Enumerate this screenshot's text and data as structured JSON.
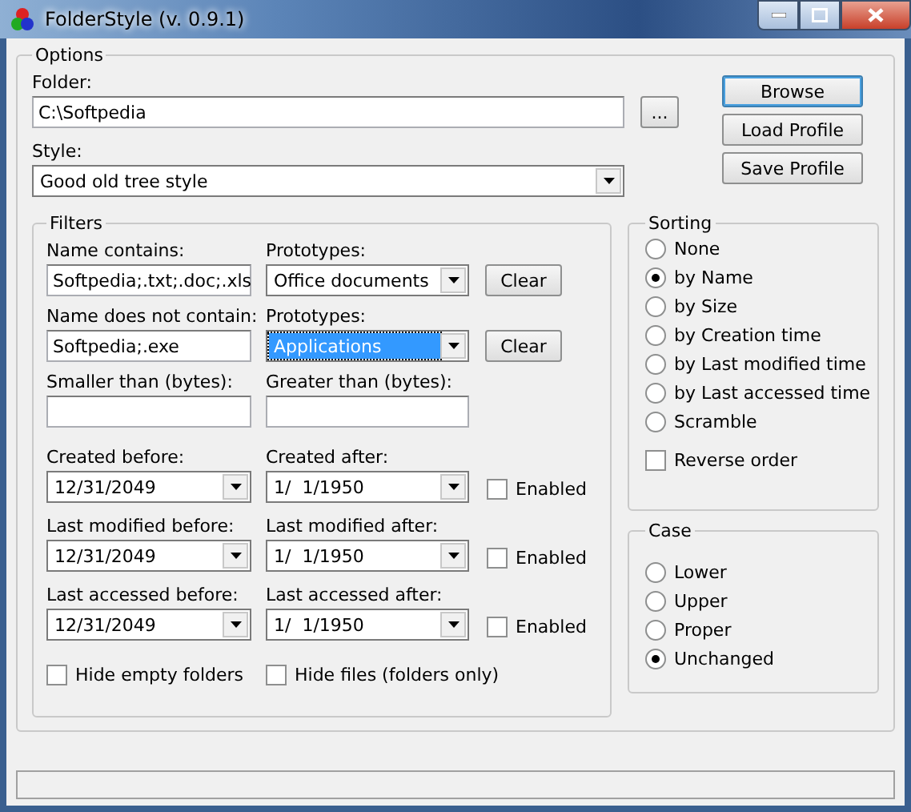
{
  "window": {
    "title": "FolderStyle (v. 0.9.1)"
  },
  "options": {
    "legend": "Options",
    "folder": {
      "label": "Folder:",
      "value": "C:\\Softpedia",
      "browse": "..."
    },
    "style": {
      "label": "Style:",
      "value": "Good old tree style"
    },
    "buttons": [
      {
        "label": "Browse",
        "default": true
      },
      {
        "label": "Load Profile",
        "default": false
      },
      {
        "label": "Save Profile",
        "default": false
      }
    ]
  },
  "filters": {
    "legend": "Filters",
    "name_rows": [
      {
        "label": "Name contains:",
        "value": "Softpedia;.txt;.doc;.xls",
        "prototype_label": "Prototypes:",
        "prototype_value": "Office documents",
        "prototype_focused": false,
        "clear": "Clear"
      },
      {
        "label": "Name does not contain:",
        "value": "Softpedia;.exe",
        "prototype_label": "Prototypes:",
        "prototype_value": "Applications",
        "prototype_focused": true,
        "clear": "Clear"
      }
    ],
    "size": {
      "smaller_label": "Smaller than (bytes):",
      "greater_label": "Greater than (bytes):"
    },
    "date_rows": [
      {
        "before_label": "Created before:",
        "before_value": "12/31/2049",
        "after_label": "Created after:",
        "after_value": "1/  1/1950",
        "enabled_label": "Enabled",
        "enabled": false
      },
      {
        "before_label": "Last modified before:",
        "before_value": "12/31/2049",
        "after_label": "Last modified after:",
        "after_value": "1/  1/1950",
        "enabled_label": "Enabled",
        "enabled": false
      },
      {
        "before_label": "Last accessed before:",
        "before_value": "12/31/2049",
        "after_label": "Last accessed after:",
        "after_value": "1/  1/1950",
        "enabled_label": "Enabled",
        "enabled": false
      }
    ],
    "checks": [
      {
        "label": "Hide empty folders",
        "checked": false
      },
      {
        "label": "Hide files (folders only)",
        "checked": false
      }
    ]
  },
  "sorting": {
    "legend": "Sorting",
    "options": [
      {
        "label": "None",
        "selected": false
      },
      {
        "label": "by Name",
        "selected": true
      },
      {
        "label": "by Size",
        "selected": false
      },
      {
        "label": "by Creation time",
        "selected": false
      },
      {
        "label": "by Last modified time",
        "selected": false
      },
      {
        "label": "by Last accessed time",
        "selected": false
      },
      {
        "label": "Scramble",
        "selected": false
      }
    ],
    "reverse": {
      "label": "Reverse order",
      "checked": false
    }
  },
  "case": {
    "legend": "Case",
    "options": [
      {
        "label": "Lower",
        "selected": false
      },
      {
        "label": "Upper",
        "selected": false
      },
      {
        "label": "Proper",
        "selected": false
      },
      {
        "label": "Unchanged",
        "selected": true
      }
    ]
  }
}
